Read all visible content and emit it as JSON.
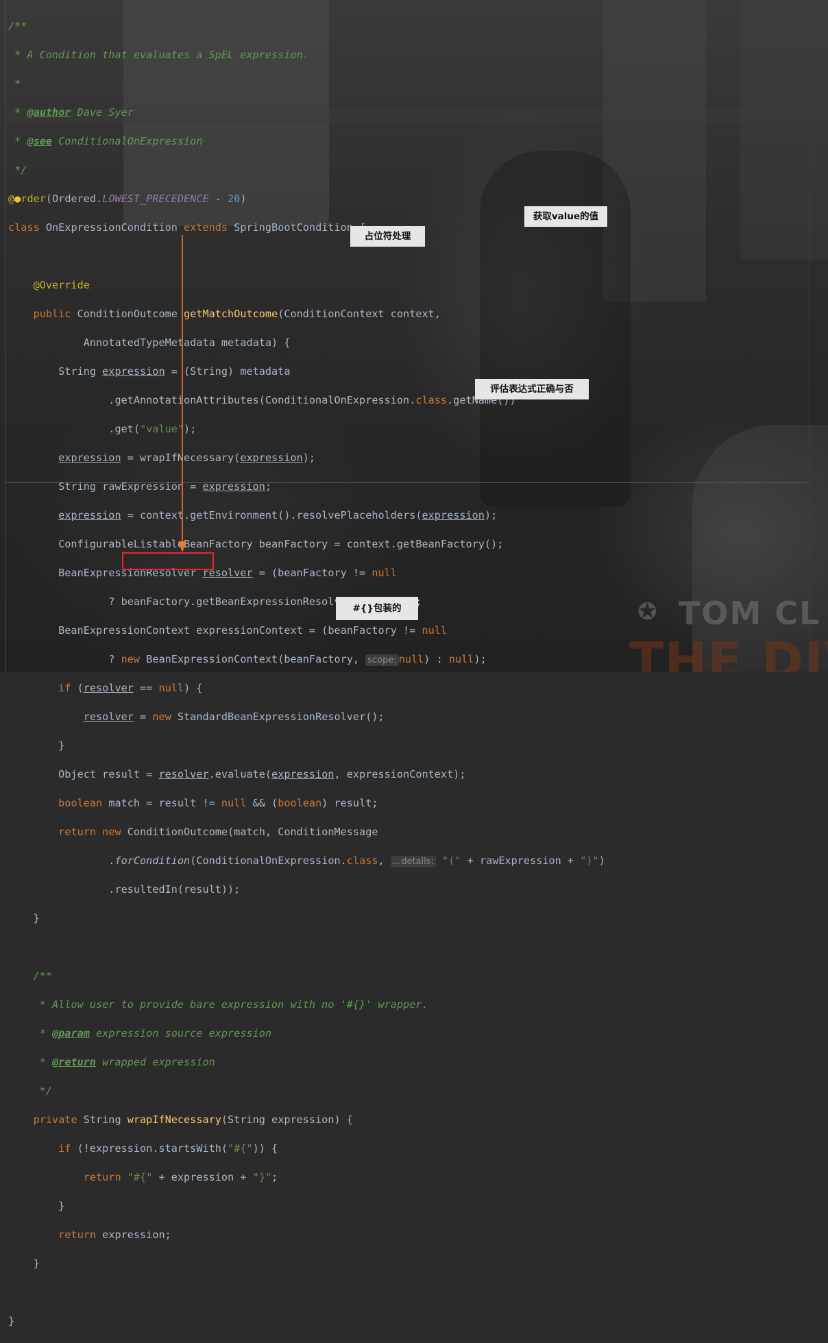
{
  "editor": {
    "javadoc_class": {
      "open": "/**",
      "desc": " * A Condition that evaluates a SpEL expression.",
      "blank": " *",
      "author_prefix": " * ",
      "author_tag": "@author",
      "author_value": " Dave Syer",
      "see_prefix": " * ",
      "see_tag": "@see",
      "see_value": " ConditionalOnExpression",
      "close": " */"
    },
    "annotation_line": {
      "at": "@",
      "order": "rder",
      "open": "(Ordered.",
      "const": "LOWEST_PRECEDENCE",
      "minus": " - ",
      "num": "20",
      "close": ")"
    },
    "class_line": {
      "kw_class": "class ",
      "name": "OnExpressionCondition",
      "kw_extends": " extends ",
      "parent": "SpringBootCondition {"
    },
    "method": {
      "override": "    @Override",
      "kw_public": "    public ",
      "ret": "ConditionOutcome ",
      "name": "getMatchOutcome",
      "params1": "(ConditionContext context,",
      "params2": "            AnnotatedTypeMetadata metadata) {"
    },
    "body": {
      "l1a": "        String ",
      "l1b": "expression",
      "l1c": " = (String) metadata",
      "l2a": "                .getAnnotationAttributes(ConditionalOnExpression.",
      "l2b": "class",
      "l2c": ".getName())",
      "l3a": "                .get(",
      "l3b": "\"value\"",
      "l3c": ");",
      "l4a": "        ",
      "l4b": "expression",
      "l4c": " = wrapIfNecessary(",
      "l4d": "expression",
      "l4e": ");",
      "l5a": "        String rawExpression = ",
      "l5b": "expression",
      "l5c": ";",
      "l6a": "        ",
      "l6b": "expression",
      "l6c": " = context.getEnvironment().resolvePlaceholders(",
      "l6d": "expression",
      "l6e": ");",
      "l7": "        ConfigurableListableBeanFactory beanFactory = context.getBeanFactory();",
      "l8a": "        BeanExpressionResolver ",
      "l8b": "resolver",
      "l8c": " = (beanFactory != ",
      "l8d": "null",
      "l9a": "                ? beanFactory.getBeanExpressionResolver() : ",
      "l9b": "null",
      "l9c": ");",
      "l10a": "        BeanExpressionContext expressionContext = (beanFactory != ",
      "l10b": "null",
      "l11a": "                ? ",
      "l11b": "new",
      "l11c": " BeanExpressionContext(beanFactory, ",
      "l11hint": "scope:",
      "l11d": "null",
      "l11e": ") : ",
      "l11f": "null",
      "l11g": ");",
      "l12a": "        ",
      "l12b": "if",
      "l12c": " (",
      "l12d": "resolver",
      "l12e": " == ",
      "l12f": "null",
      "l12g": ") {",
      "l13a": "            ",
      "l13b": "resolver",
      "l13c": " = ",
      "l13d": "new",
      "l13e": " StandardBeanExpressionResolver();",
      "l14": "        }",
      "l15a": "        Object result = ",
      "l15b": "resolver",
      "l15c": ".evaluate(",
      "l15d": "expression",
      "l15e": ", expressionContext);",
      "l16a": "        ",
      "l16b": "boolean",
      "l16c": " match = result != ",
      "l16d": "null",
      "l16e": " && (",
      "l16f": "boolean",
      "l16g": ") result;",
      "l17a": "        ",
      "l17b": "return new",
      "l17c": " ConditionOutcome(match, ConditionMessage",
      "l18a": "                .",
      "l18b": "forCondition",
      "l18c": "(ConditionalOnExpression.",
      "l18d": "class",
      "l18e": ", ",
      "l18hint": "...details:",
      "l18f": " ",
      "l18g": "\"(\"",
      "l18h": " + rawExpression + ",
      "l18i": "\")\"",
      "l18j": ")",
      "l19": "                .resultedIn(result));",
      "l20": "    }"
    },
    "javadoc_method": {
      "open": "    /**",
      "desc": "     * Allow user to provide bare expression with no '#{}' wrapper.",
      "param_prefix": "     * ",
      "param_tag": "@param",
      "param_value": " expression source expression",
      "return_prefix": "     * ",
      "return_tag": "@return",
      "return_value": " wrapped expression",
      "close": "     */"
    },
    "wrap_method": {
      "l1a": "    ",
      "l1b": "private",
      "l1c": " String ",
      "l1d": "wrapIfNecessary",
      "l1e": "(String expression) {",
      "l2a": "        ",
      "l2b": "if",
      "l2c": " (!expression.startsWith(",
      "l2d": "\"#{\"",
      "l2e": ")) {",
      "l3a": "            ",
      "l3b": "return",
      "l3c": " ",
      "l3d": "\"#{\"",
      "l3e": " + expression + ",
      "l3f": "\"}\"",
      "l3g": ";",
      "l4": "        }",
      "l5a": "        ",
      "l5b": "return",
      "l5c": " expression;",
      "l6": "    }",
      "l7": "}"
    }
  },
  "callouts": {
    "get_value": "获取value的值",
    "placeholder": "占位符处理",
    "evaluate": "评估表达式正确与否",
    "wrap": "#{}包装的"
  },
  "background": {
    "logo_top": "TOM CL",
    "logo_bottom": "THE DIV"
  },
  "colors": {
    "editor_bg": "#2b2b2b",
    "keyword": "#cc7832",
    "function": "#ffc66d",
    "string": "#6a8759",
    "number": "#6897bb",
    "comment": "#629755",
    "annotation": "#bbb529",
    "arrow": "#f07a28",
    "highlight_box": "#e8262e"
  }
}
